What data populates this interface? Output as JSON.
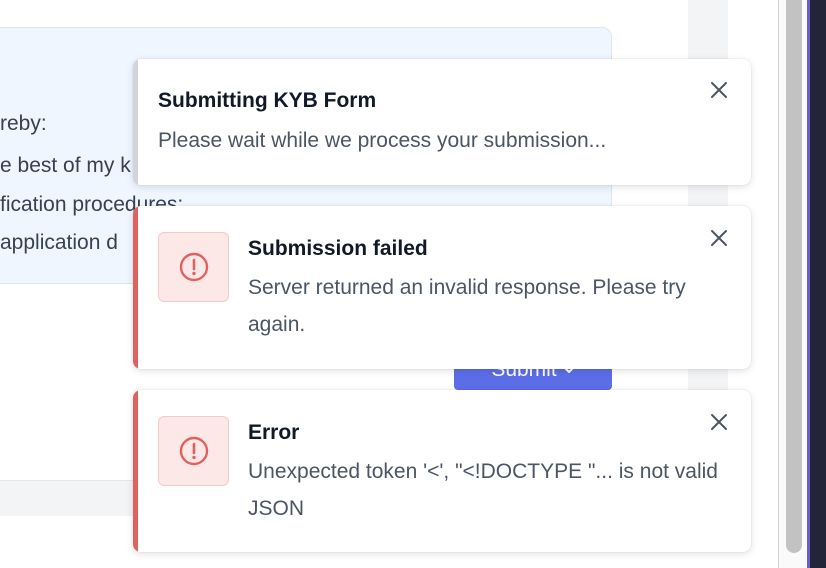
{
  "background": {
    "card_lines": [
      "reby:",
      "e best of my k",
      "fication procedures:",
      "application d"
    ],
    "submit_label": "Submit",
    "submit_icon": "chevron-down-icon"
  },
  "toasts": [
    {
      "kind": "info",
      "title": "Submitting KYB Form",
      "message": "Please wait while we process your submission...",
      "close_icon": "close-icon"
    },
    {
      "kind": "error",
      "title": "Submission failed",
      "message": "Server returned an invalid response. Please try again.",
      "icon": "alert-circle-icon",
      "close_icon": "close-icon"
    },
    {
      "kind": "error",
      "title": "Error",
      "message": "Unexpected token '<', \"<!DOCTYPE \"... is not valid JSON",
      "icon": "alert-circle-icon",
      "close_icon": "close-icon"
    }
  ],
  "colors": {
    "error_accent": "#e0625f",
    "info_accent": "#d1d5db",
    "error_icon_bg": "#fde8e8",
    "submit_button": "#5b6ee8",
    "card_background": "#eff6ff"
  }
}
